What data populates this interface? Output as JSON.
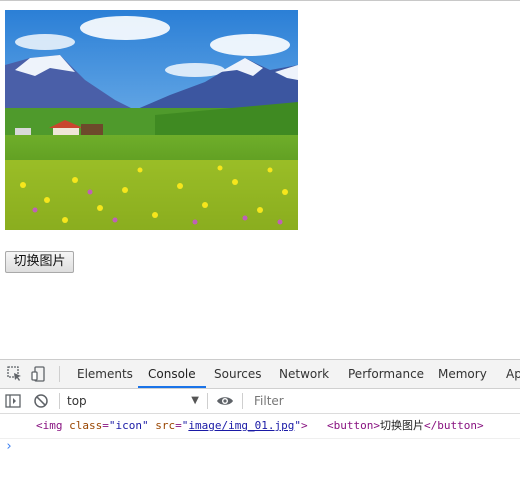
{
  "page": {
    "button_label": "切换图片"
  },
  "devtools": {
    "tabs": [
      {
        "label": "Elements",
        "active": false
      },
      {
        "label": "Console",
        "active": true
      },
      {
        "label": "Sources",
        "active": false
      },
      {
        "label": "Network",
        "active": false
      },
      {
        "label": "Performance",
        "active": false
      },
      {
        "label": "Memory",
        "active": false
      },
      {
        "label": "Ap",
        "active": false
      }
    ],
    "context": "top",
    "filter_placeholder": "Filter",
    "console_output": {
      "img_open": "<img",
      "img_attr_class": "class",
      "img_class_value": "icon",
      "img_attr_src": "src",
      "img_src_value": "image/img_01.jpg",
      "img_close": ">",
      "button_open": "<button>",
      "button_text": "切换图片",
      "button_close": "</button>"
    }
  },
  "colors": {
    "accent": "#1a73e8",
    "tag": "#881280",
    "attribute": "#994500",
    "value": "#1a1aa6",
    "prompt": "#367cf1"
  },
  "icons": [
    "inspect-element-icon",
    "device-toolbar-icon",
    "sidebar-toggle-icon",
    "clear-console-icon",
    "dropdown-arrow-icon",
    "eye-icon",
    "prompt-chevron-icon"
  ]
}
